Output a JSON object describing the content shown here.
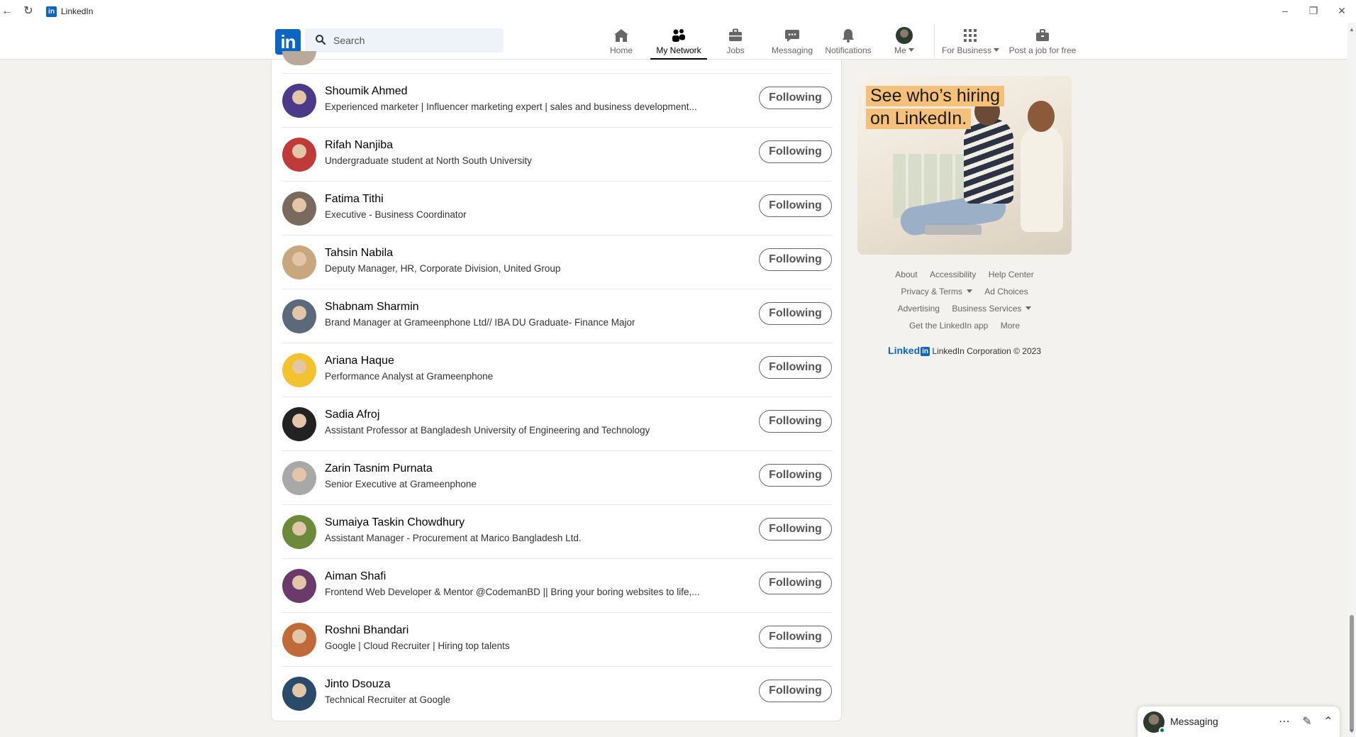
{
  "window": {
    "title": "LinkedIn",
    "app_icon_letter": "in"
  },
  "header": {
    "logo_text": "in",
    "search_placeholder": "Search",
    "nav": [
      {
        "label": "Home",
        "icon": "home-icon"
      },
      {
        "label": "My Network",
        "icon": "network-icon",
        "active": true
      },
      {
        "label": "Jobs",
        "icon": "briefcase-icon"
      },
      {
        "label": "Messaging",
        "icon": "chat-icon"
      },
      {
        "label": "Notifications",
        "icon": "bell-icon"
      },
      {
        "label": "Me",
        "icon": "avatar"
      },
      {
        "label": "For Business",
        "icon": "grid-icon"
      },
      {
        "label": "Post a job for free",
        "icon": "job-post-icon"
      }
    ]
  },
  "following_list": [
    {
      "name": "Shoumik Ahmed",
      "headline": "Experienced marketer | Influencer marketing expert | sales and business development...",
      "button": "Following",
      "avatar_color": "#4b3a8a"
    },
    {
      "name": "Rifah Nanjiba",
      "headline": "Undergraduate student at North South University",
      "button": "Following",
      "avatar_color": "#c03a3a"
    },
    {
      "name": "Fatima Tithi",
      "headline": "Executive - Business Coordinator",
      "button": "Following",
      "avatar_color": "#7a6a5e"
    },
    {
      "name": "Tahsin Nabila",
      "headline": "Deputy Manager, HR, Corporate Division, United Group",
      "button": "Following",
      "avatar_color": "#c9a77e"
    },
    {
      "name": "Shabnam Sharmin",
      "headline": "Brand Manager at Grameenphone Ltd// IBA DU Graduate- Finance Major",
      "button": "Following",
      "avatar_color": "#5a6a7a"
    },
    {
      "name": "Ariana Haque",
      "headline": "Performance Analyst at Grameenphone",
      "button": "Following",
      "avatar_color": "#f2c230"
    },
    {
      "name": "Sadia Afroj",
      "headline": "Assistant Professor at Bangladesh University of Engineering and Technology",
      "button": "Following",
      "avatar_color": "#222222"
    },
    {
      "name": "Zarin Tasnim Purnata",
      "headline": "Senior Executive at Grameenphone",
      "button": "Following",
      "avatar_color": "#a8a8a8"
    },
    {
      "name": "Sumaiya Taskin Chowdhury",
      "headline": "Assistant Manager - Procurement at Marico Bangladesh Ltd.",
      "button": "Following",
      "avatar_color": "#6b8a3a"
    },
    {
      "name": "Aiman Shafi",
      "headline": "Frontend Web Developer & Mentor @CodemanBD || Bring your boring websites to life,...",
      "button": "Following",
      "avatar_color": "#6a3a6a"
    },
    {
      "name": "Roshni Bhandari",
      "headline": "Google | Cloud Recruiter | Hiring top talents",
      "button": "Following",
      "avatar_color": "#c06a3a"
    },
    {
      "name": "Jinto Dsouza",
      "headline": "Technical Recruiter at Google",
      "button": "Following",
      "avatar_color": "#2a4a6a"
    }
  ],
  "ad": {
    "line1": "See who’s hiring",
    "line2": "on LinkedIn."
  },
  "footer": {
    "links": [
      [
        "About",
        "Accessibility",
        "Help Center"
      ],
      [
        "Privacy & Terms",
        "Ad Choices"
      ],
      [
        "Advertising",
        "Business Services"
      ],
      [
        "Get the LinkedIn app",
        "More"
      ]
    ],
    "brand_text": "Linked",
    "brand_in": "in",
    "copyright": "LinkedIn Corporation © 2023"
  },
  "messaging": {
    "label": "Messaging"
  },
  "colors": {
    "brand_blue": "#0a66c2",
    "page_bg": "#f4f2ee",
    "online_green": "#01754f"
  }
}
